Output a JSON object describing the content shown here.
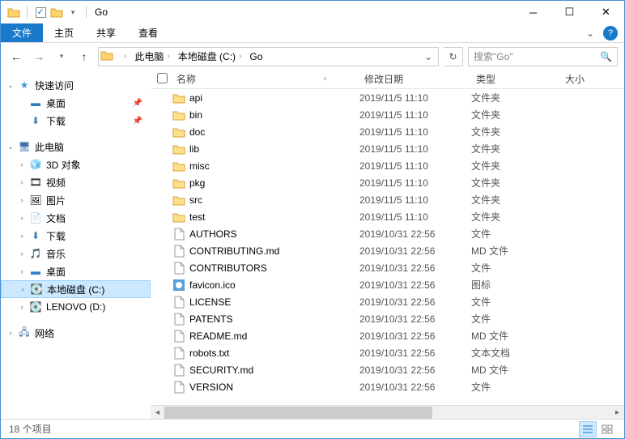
{
  "window": {
    "title": "Go"
  },
  "ribbon": {
    "file": "文件",
    "tabs": [
      "主页",
      "共享",
      "查看"
    ]
  },
  "breadcrumbs": [
    {
      "label": "此电脑"
    },
    {
      "label": "本地磁盘 (C:)"
    },
    {
      "label": "Go"
    }
  ],
  "search": {
    "placeholder": "搜索\"Go\""
  },
  "columns": {
    "name": "名称",
    "date": "修改日期",
    "type": "类型",
    "size": "大小"
  },
  "nav": {
    "quick": {
      "label": "快速访问",
      "children": [
        {
          "label": "桌面",
          "icon": "desktop",
          "pinned": true
        },
        {
          "label": "下载",
          "icon": "downloads",
          "pinned": true
        }
      ]
    },
    "thispc": {
      "label": "此电脑",
      "children": [
        {
          "label": "3D 对象",
          "icon": "3d"
        },
        {
          "label": "视频",
          "icon": "video"
        },
        {
          "label": "图片",
          "icon": "pics"
        },
        {
          "label": "文档",
          "icon": "docs"
        },
        {
          "label": "下载",
          "icon": "downloads"
        },
        {
          "label": "音乐",
          "icon": "music"
        },
        {
          "label": "桌面",
          "icon": "desktop"
        },
        {
          "label": "本地磁盘 (C:)",
          "icon": "drive",
          "selected": true
        },
        {
          "label": "LENOVO (D:)",
          "icon": "drive"
        }
      ]
    },
    "network": {
      "label": "网络"
    }
  },
  "files": [
    {
      "name": "api",
      "date": "2019/11/5 11:10",
      "type": "文件夹",
      "kind": "folder"
    },
    {
      "name": "bin",
      "date": "2019/11/5 11:10",
      "type": "文件夹",
      "kind": "folder"
    },
    {
      "name": "doc",
      "date": "2019/11/5 11:10",
      "type": "文件夹",
      "kind": "folder"
    },
    {
      "name": "lib",
      "date": "2019/11/5 11:10",
      "type": "文件夹",
      "kind": "folder"
    },
    {
      "name": "misc",
      "date": "2019/11/5 11:10",
      "type": "文件夹",
      "kind": "folder"
    },
    {
      "name": "pkg",
      "date": "2019/11/5 11:10",
      "type": "文件夹",
      "kind": "folder"
    },
    {
      "name": "src",
      "date": "2019/11/5 11:10",
      "type": "文件夹",
      "kind": "folder"
    },
    {
      "name": "test",
      "date": "2019/11/5 11:10",
      "type": "文件夹",
      "kind": "folder"
    },
    {
      "name": "AUTHORS",
      "date": "2019/10/31 22:56",
      "type": "文件",
      "kind": "file"
    },
    {
      "name": "CONTRIBUTING.md",
      "date": "2019/10/31 22:56",
      "type": "MD 文件",
      "kind": "file"
    },
    {
      "name": "CONTRIBUTORS",
      "date": "2019/10/31 22:56",
      "type": "文件",
      "kind": "file"
    },
    {
      "name": "favicon.ico",
      "date": "2019/10/31 22:56",
      "type": "图标",
      "kind": "ico"
    },
    {
      "name": "LICENSE",
      "date": "2019/10/31 22:56",
      "type": "文件",
      "kind": "file"
    },
    {
      "name": "PATENTS",
      "date": "2019/10/31 22:56",
      "type": "文件",
      "kind": "file"
    },
    {
      "name": "README.md",
      "date": "2019/10/31 22:56",
      "type": "MD 文件",
      "kind": "file"
    },
    {
      "name": "robots.txt",
      "date": "2019/10/31 22:56",
      "type": "文本文档",
      "kind": "file"
    },
    {
      "name": "SECURITY.md",
      "date": "2019/10/31 22:56",
      "type": "MD 文件",
      "kind": "file"
    },
    {
      "name": "VERSION",
      "date": "2019/10/31 22:56",
      "type": "文件",
      "kind": "file"
    }
  ],
  "status": {
    "count": "18 个项目"
  }
}
